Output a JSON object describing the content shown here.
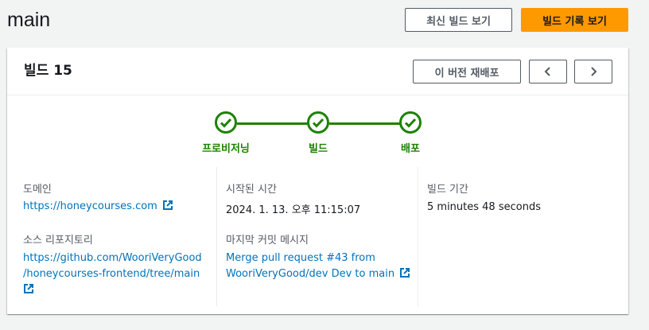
{
  "page": {
    "title": "main",
    "latest_build_button": "최신 빌드 보기",
    "build_history_button": "빌드 기록 보기"
  },
  "card": {
    "title": "빌드 15",
    "redeploy_button": "이 버전 재배포",
    "prev_icon": "chevron-left-icon",
    "next_icon": "chevron-right-icon"
  },
  "steps": [
    {
      "label": "프로비저닝",
      "status": "complete"
    },
    {
      "label": "빌드",
      "status": "complete"
    },
    {
      "label": "배포",
      "status": "complete"
    }
  ],
  "details": {
    "domain_label": "도메인",
    "domain_value": "https://honeycourses.com",
    "repo_label": "소스 리포지토리",
    "repo_line1": "https://github.com/WooriVeryGood",
    "repo_line2": "/honeycourses-frontend/tree/main",
    "start_label": "시작된 시간",
    "start_value": "2024. 1. 13. 오후 11:15:07",
    "commit_label": "마지막 커밋 메시지",
    "commit_line1": "Merge pull request #43 from",
    "commit_line2": "WooriVeryGood/dev Dev to main",
    "duration_label": "빌드 기간",
    "duration_value": "5 minutes 48 seconds"
  },
  "colors": {
    "success": "#1d8102",
    "link": "#0073bb",
    "primary": "#ff9900"
  }
}
